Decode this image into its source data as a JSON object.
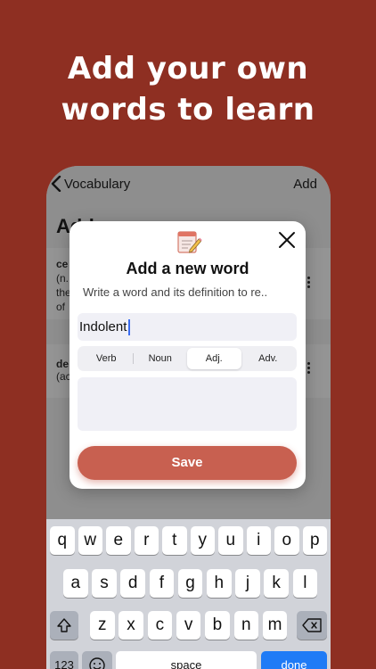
{
  "headline": {
    "line1": "Add your own",
    "line2": "words to learn"
  },
  "nav": {
    "back_label": "Vocabulary",
    "add_label": "Add"
  },
  "background": {
    "title": "Add",
    "row1_lines": [
      "ce",
      "(n.",
      "the",
      "of"
    ],
    "row2_lines": [
      "de",
      "(ac"
    ]
  },
  "modal": {
    "title": "Add a new word",
    "subtitle": "Write a word and its definition to re..",
    "word_value": "Indolent",
    "word_type_options": [
      "Verb",
      "Noun",
      "Adj.",
      "Adv."
    ],
    "selected_type": "Adj.",
    "save_label": "Save"
  },
  "keyboard": {
    "row1": [
      "q",
      "w",
      "e",
      "r",
      "t",
      "y",
      "u",
      "i",
      "o",
      "p"
    ],
    "row2": [
      "a",
      "s",
      "d",
      "f",
      "g",
      "h",
      "j",
      "k",
      "l"
    ],
    "row3": [
      "z",
      "x",
      "c",
      "v",
      "b",
      "n",
      "m"
    ],
    "numbers_label": "123",
    "space_label": "space",
    "done_label": "done"
  },
  "colors": {
    "background": "#8e2f22",
    "accent": "#c86050",
    "done": "#1f7bf6"
  }
}
